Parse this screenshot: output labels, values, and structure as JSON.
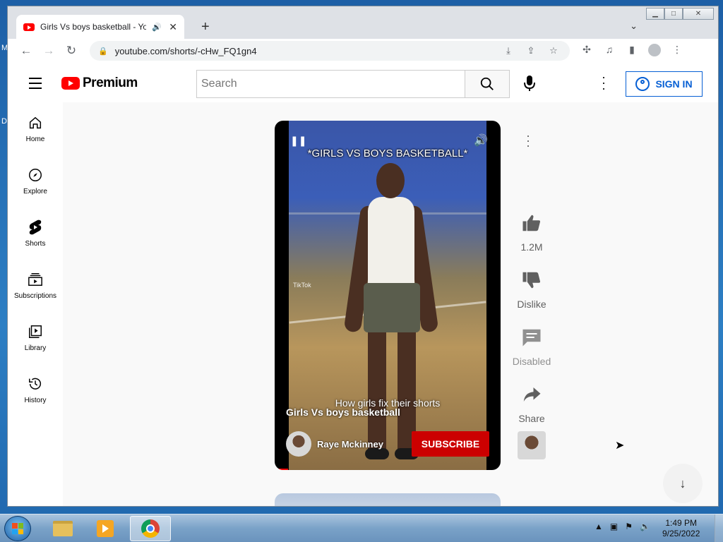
{
  "desktop": {
    "edge_text_1": "M",
    "edge_text_2": "D"
  },
  "browser": {
    "tab_title": "Girls Vs boys basketball - YouTube",
    "url": "youtube.com/shorts/-cHw_FQ1gn4"
  },
  "youtube": {
    "logo_text": "Premium",
    "search_placeholder": "Search",
    "sign_in_label": "SIGN IN",
    "sidebar": [
      {
        "label": "Home",
        "icon": "home-icon"
      },
      {
        "label": "Explore",
        "icon": "compass-icon"
      },
      {
        "label": "Shorts",
        "icon": "shorts-icon"
      },
      {
        "label": "Subscriptions",
        "icon": "subscriptions-icon"
      },
      {
        "label": "Library",
        "icon": "library-icon"
      },
      {
        "label": "History",
        "icon": "history-icon"
      }
    ],
    "short": {
      "overlay_title": "*GIRLS VS BOYS BASKETBALL*",
      "caption": "How girls fix their shorts",
      "watermark": "TikTok",
      "video_title": "Girls Vs boys basketball",
      "channel": "Raye Mckinney",
      "subscribe_label": "SUBSCRIBE"
    },
    "actions": {
      "likes": "1.2M",
      "dislike": "Dislike",
      "comments": "Disabled",
      "share": "Share"
    }
  },
  "taskbar": {
    "time": "1:49 PM",
    "date": "9/25/2022"
  }
}
